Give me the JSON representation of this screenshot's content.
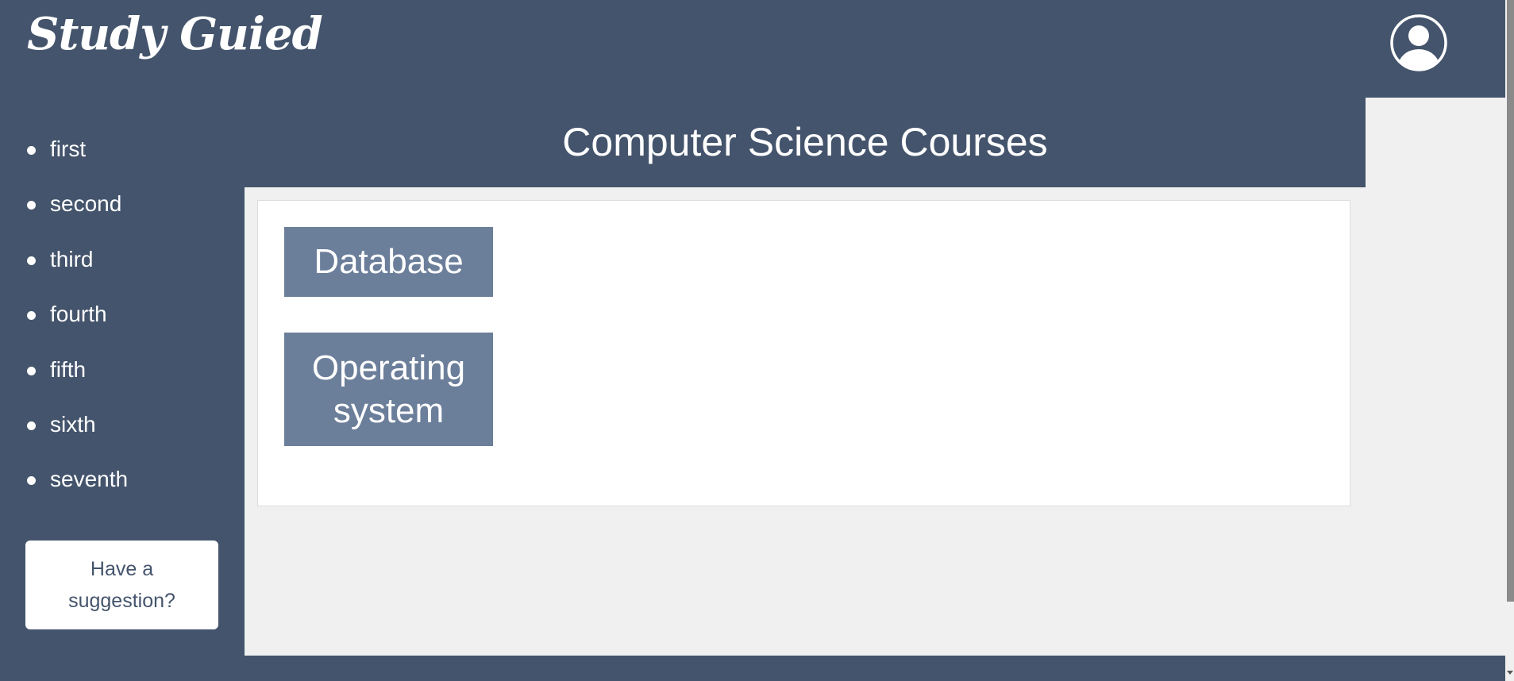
{
  "header": {
    "logo_text": "Study Guied",
    "avatar_icon": "user-circle-icon"
  },
  "sidebar": {
    "items": [
      {
        "label": "first"
      },
      {
        "label": "second"
      },
      {
        "label": "third"
      },
      {
        "label": "fourth"
      },
      {
        "label": "fifth"
      },
      {
        "label": "sixth"
      },
      {
        "label": "seventh"
      }
    ],
    "suggestion_button": "Have a suggestion?"
  },
  "main": {
    "title": "Computer Science Courses",
    "courses": [
      {
        "label": "Database"
      },
      {
        "label": "Operating system"
      }
    ]
  },
  "colors": {
    "primary": "#44546c",
    "card": "#6b7e9a",
    "background": "#f0f0f0"
  }
}
